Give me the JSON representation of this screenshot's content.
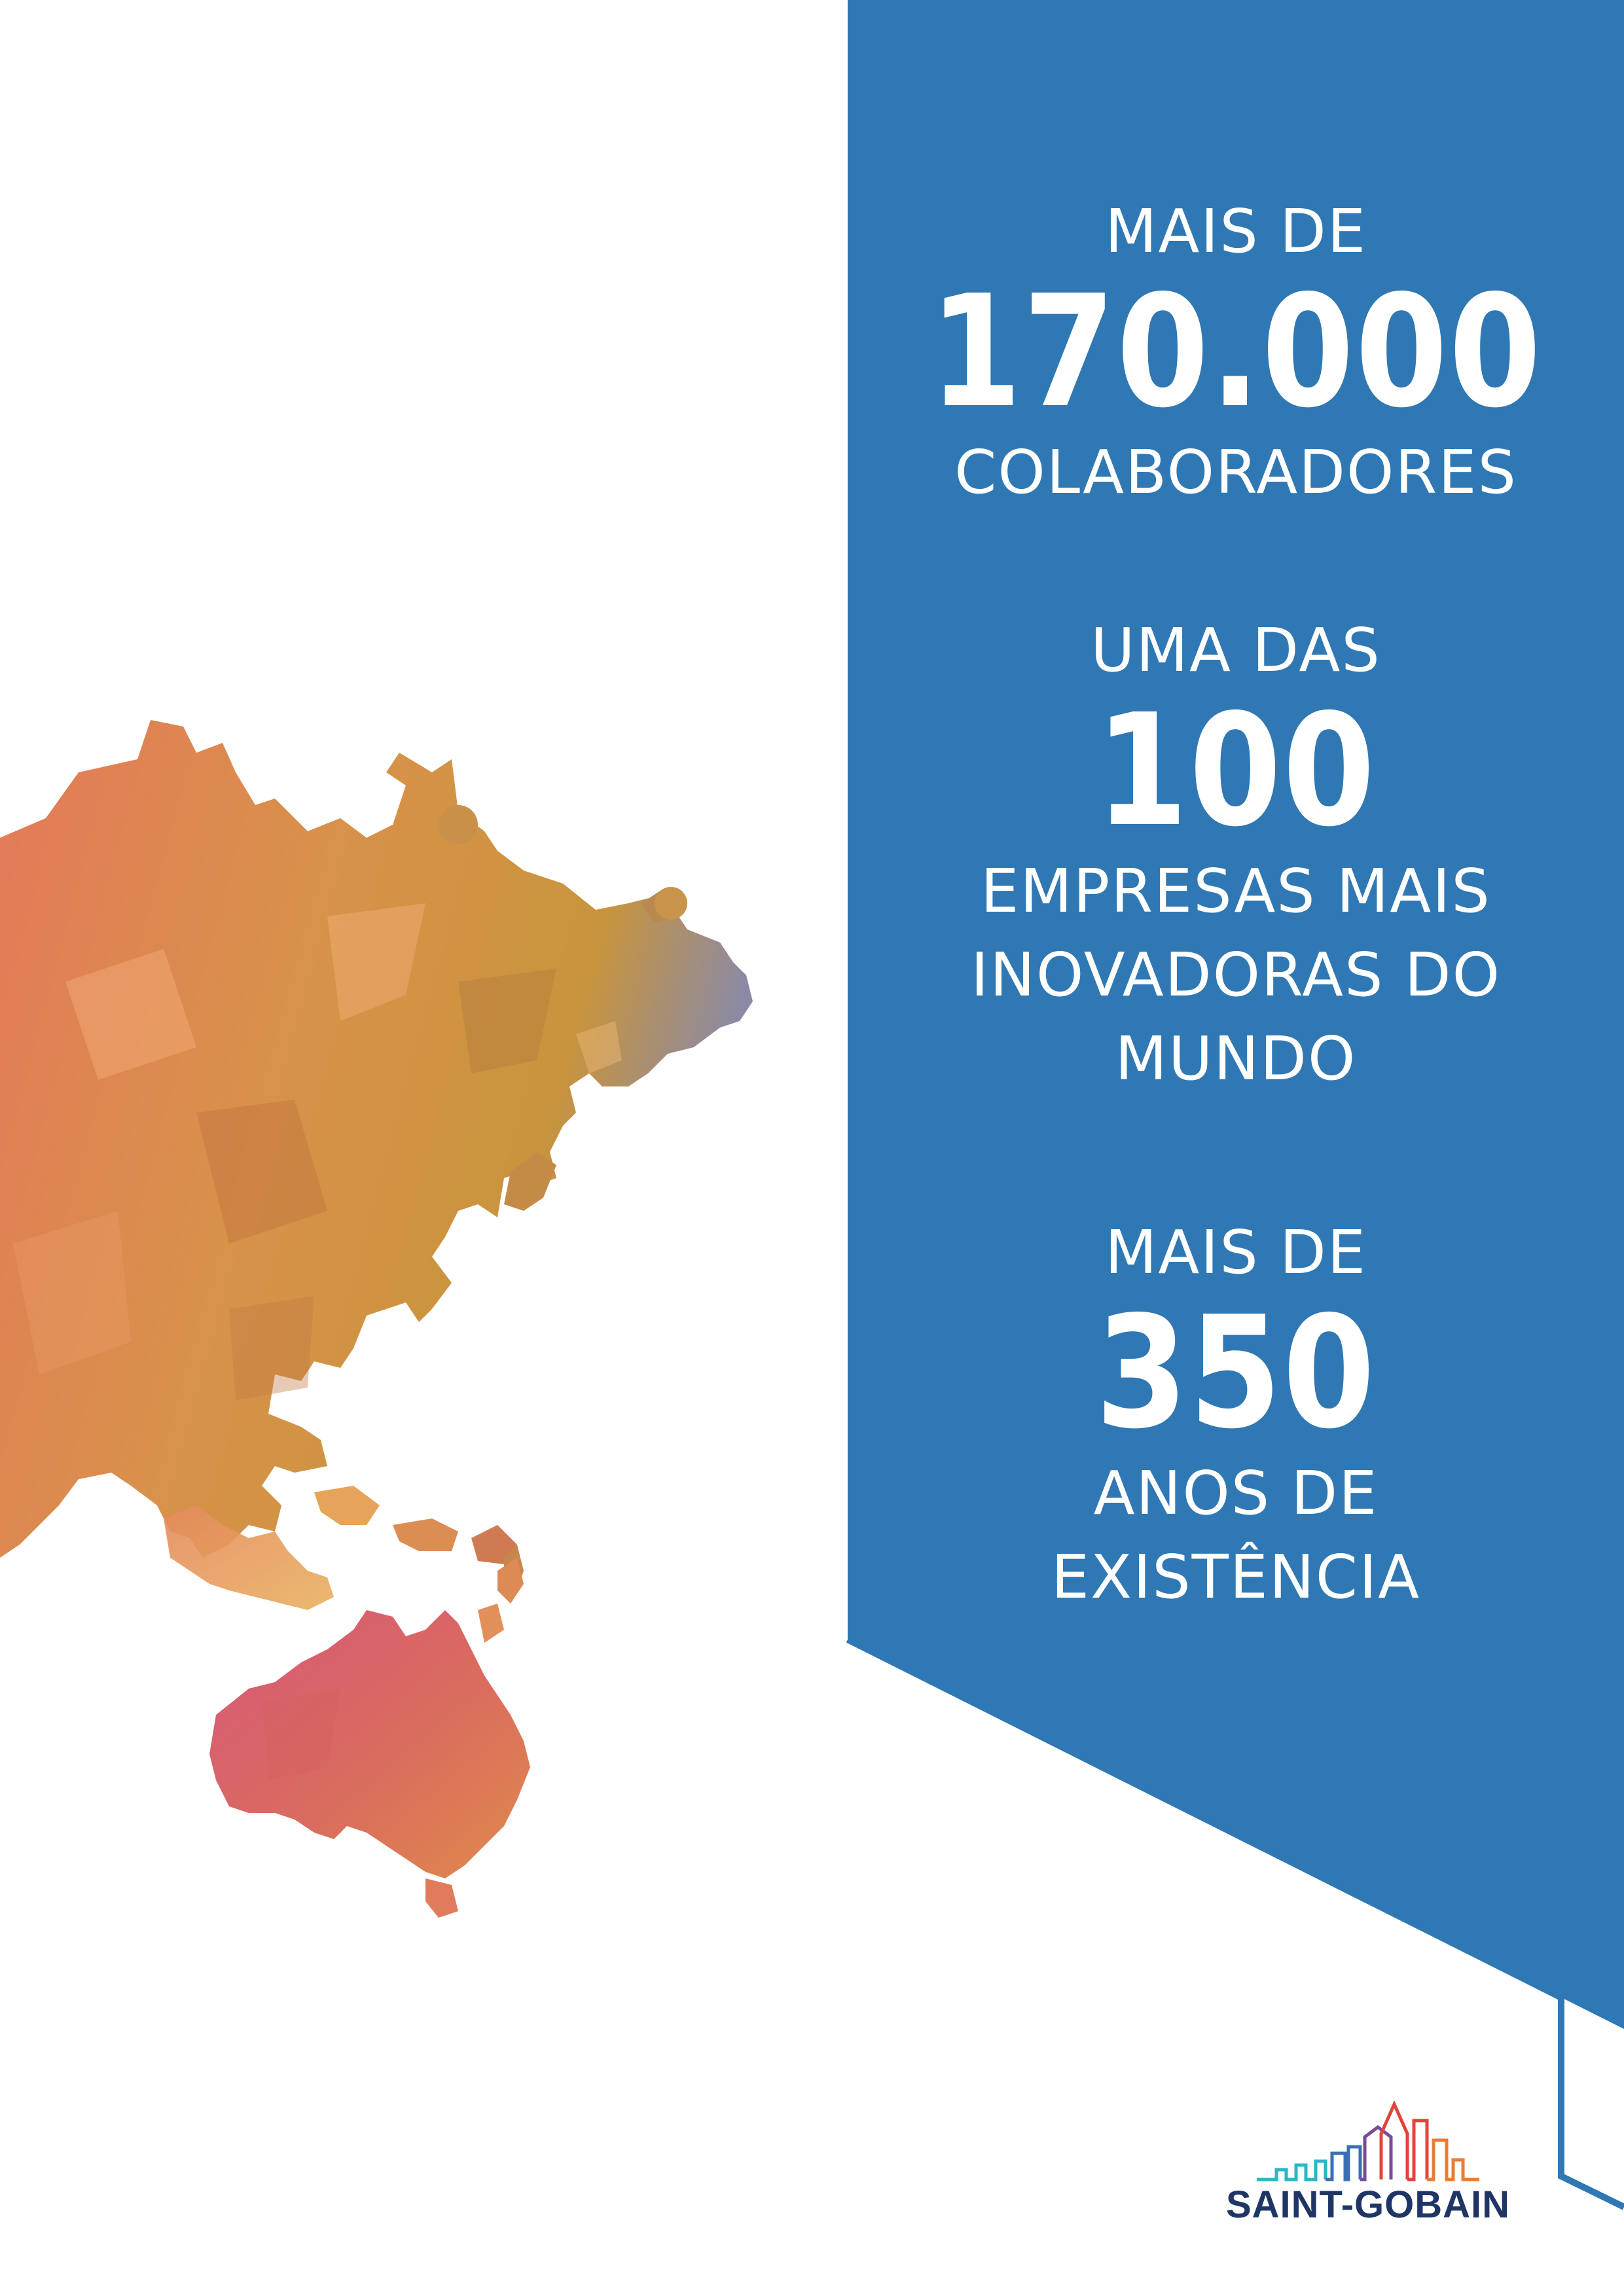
{
  "colors": {
    "panel_blue": "#2f78b4",
    "outline_blue": "#2f78b4",
    "map_orange": "#e2955c",
    "map_pink": "#d85a7a",
    "logo_navy": "#1f3566"
  },
  "stats": [
    {
      "line1": "MAIS DE",
      "number": "170.000",
      "line2": "COLABORADORES",
      "line3": "",
      "line4": ""
    },
    {
      "line1": "UMA DAS",
      "number": "100",
      "line2": "EMPRESAS MAIS",
      "line3": "INOVADORAS DO",
      "line4": "MUNDO"
    },
    {
      "line1": "MAIS DE",
      "number": "350",
      "line2": "ANOS DE",
      "line3": "EXISTÊNCIA",
      "line4": ""
    }
  ],
  "logo": {
    "text": "SAINT-GOBAIN"
  }
}
